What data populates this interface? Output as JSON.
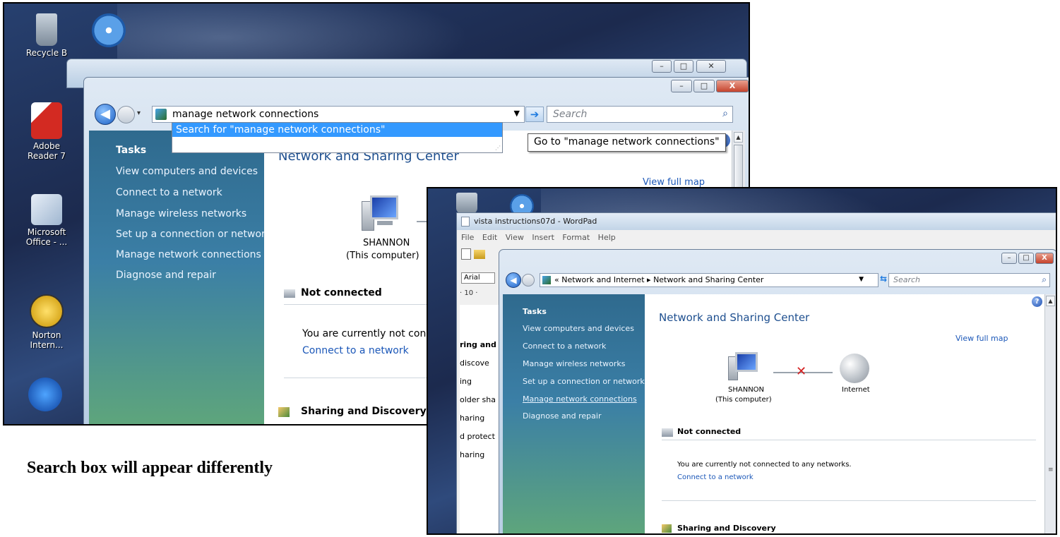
{
  "caption": "Search box will appear differently",
  "shot1": {
    "desktop_icons": [
      {
        "label": "Recycle B",
        "icon": "recycle-bin-icon"
      },
      {
        "label": "Adobe Reader 7",
        "icon": "adobe-reader-icon"
      },
      {
        "label": "Microsoft Office - ...",
        "icon": "office-icon"
      },
      {
        "label": "Norton Intern...",
        "icon": "norton-icon"
      }
    ],
    "address": {
      "value": "manage network connections",
      "suggestion": "Search for \"manage network connections\"",
      "tooltip": "Go to \"manage network connections\"",
      "search_placeholder": "Search"
    },
    "tasks": {
      "heading": "Tasks",
      "items": [
        "View computers and devices",
        "Connect to a network",
        "Manage wireless networks",
        "Set up a connection or network",
        "Manage network connections",
        "Diagnose and repair"
      ]
    },
    "content": {
      "title": "Network and Sharing Center",
      "view_full_map": "View full map",
      "computer_name": "SHANNON",
      "computer_sub": "(This computer)",
      "status_heading": "Not connected",
      "status_text": "You are currently not connect",
      "connect_link": "Connect to a network",
      "sharing_heading": "Sharing and Discovery"
    },
    "window_controls": {
      "minimize": "–",
      "maximize": "□",
      "close": "X"
    }
  },
  "shot2": {
    "wordpad": {
      "title": "vista instructions07d - WordPad",
      "menu": [
        "File",
        "Edit",
        "View",
        "Insert",
        "Format",
        "Help"
      ],
      "font": "Arial",
      "ruler": "· 10 ·",
      "doc_fragments": [
        "ring and",
        "discove",
        "ing",
        "older sha",
        "haring",
        "d protect",
        "haring"
      ]
    },
    "breadcrumb": {
      "prefix": "«",
      "parent": "Network and Internet",
      "separator": "▸",
      "current": "Network and Sharing Center",
      "search_placeholder": "Search"
    },
    "tasks": {
      "heading": "Tasks",
      "items": [
        "View computers and devices",
        "Connect to a network",
        "Manage wireless networks",
        "Set up a connection or network",
        "Manage network connections",
        "Diagnose and repair"
      ]
    },
    "content": {
      "title": "Network and Sharing Center",
      "view_full_map": "View full map",
      "computer_name": "SHANNON",
      "computer_sub": "(This computer)",
      "internet": "Internet",
      "status_heading": "Not connected",
      "status_text": "You are currently not connected to any networks.",
      "connect_link": "Connect to a network",
      "sharing_heading": "Sharing and Discovery"
    },
    "window_controls": {
      "minimize": "–",
      "maximize": "□",
      "close": "X"
    }
  }
}
